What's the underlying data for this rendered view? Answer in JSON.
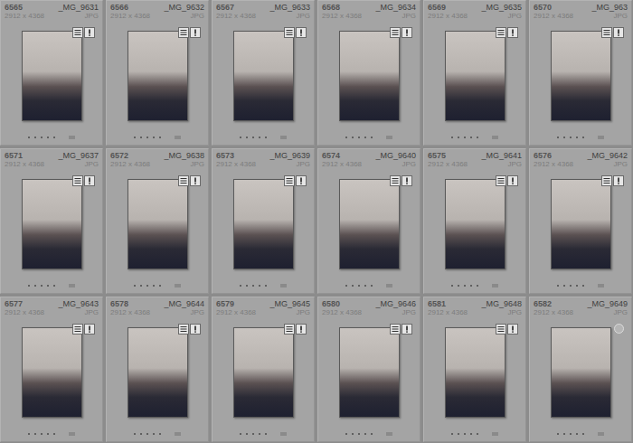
{
  "cells": [
    {
      "number": "6565",
      "filename": "_MG_9631",
      "size": "2912 x 4368",
      "type": "JPG",
      "stars": 0,
      "badges": true
    },
    {
      "number": "6566",
      "filename": "_MG_9632",
      "size": "2912 x 4368",
      "type": "JPG",
      "stars": 0,
      "badges": true
    },
    {
      "number": "6567",
      "filename": "_MG_9633",
      "size": "2912 x 4368",
      "type": "JPG",
      "stars": 0,
      "badges": true
    },
    {
      "number": "6568",
      "filename": "_MG_9634",
      "size": "2912 x 4368",
      "type": "JPG",
      "stars": 0,
      "badges": true
    },
    {
      "number": "6569",
      "filename": "_MG_9635",
      "size": "2912 x 4368",
      "type": "JPG",
      "stars": 0,
      "badges": true
    },
    {
      "number": "6570",
      "filename": "_MG_963",
      "size": "2912 x 4368",
      "type": "JPG",
      "stars": 0,
      "badges": true
    },
    {
      "number": "6571",
      "filename": "_MG_9637",
      "size": "2912 x 4368",
      "type": "JPG",
      "stars": 0,
      "badges": true
    },
    {
      "number": "6572",
      "filename": "_MG_9638",
      "size": "2912 x 4368",
      "type": "JPG",
      "stars": 0,
      "badges": true
    },
    {
      "number": "6573",
      "filename": "_MG_9639",
      "size": "2912 x 4368",
      "type": "JPG",
      "stars": 0,
      "badges": true
    },
    {
      "number": "6574",
      "filename": "_MG_9640",
      "size": "2912 x 4368",
      "type": "JPG",
      "stars": 0,
      "badges": true
    },
    {
      "number": "6575",
      "filename": "_MG_9641",
      "size": "2912 x 4368",
      "type": "JPG",
      "stars": 0,
      "badges": true
    },
    {
      "number": "6576",
      "filename": "_MG_9642",
      "size": "2912 x 4368",
      "type": "JPG",
      "stars": 0,
      "badges": true
    },
    {
      "number": "6577",
      "filename": "_MG_9643",
      "size": "2912 x 4368",
      "type": "JPG",
      "stars": 0,
      "badges": true
    },
    {
      "number": "6578",
      "filename": "_MG_9644",
      "size": "2912 x 4368",
      "type": "JPG",
      "stars": 0,
      "badges": true
    },
    {
      "number": "6579",
      "filename": "_MG_9645",
      "size": "2912 x 4368",
      "type": "JPG",
      "stars": 0,
      "badges": true
    },
    {
      "number": "6580",
      "filename": "_MG_9646",
      "size": "2912 x 4368",
      "type": "JPG",
      "stars": 0,
      "badges": true
    },
    {
      "number": "6581",
      "filename": "_MG_9648",
      "size": "2912 x 4368",
      "type": "JPG",
      "stars": 0,
      "badges": true
    },
    {
      "number": "6582",
      "filename": "_MG_9649",
      "size": "2912 x 4368",
      "type": "JPG",
      "stars": 0,
      "badges": false
    }
  ]
}
